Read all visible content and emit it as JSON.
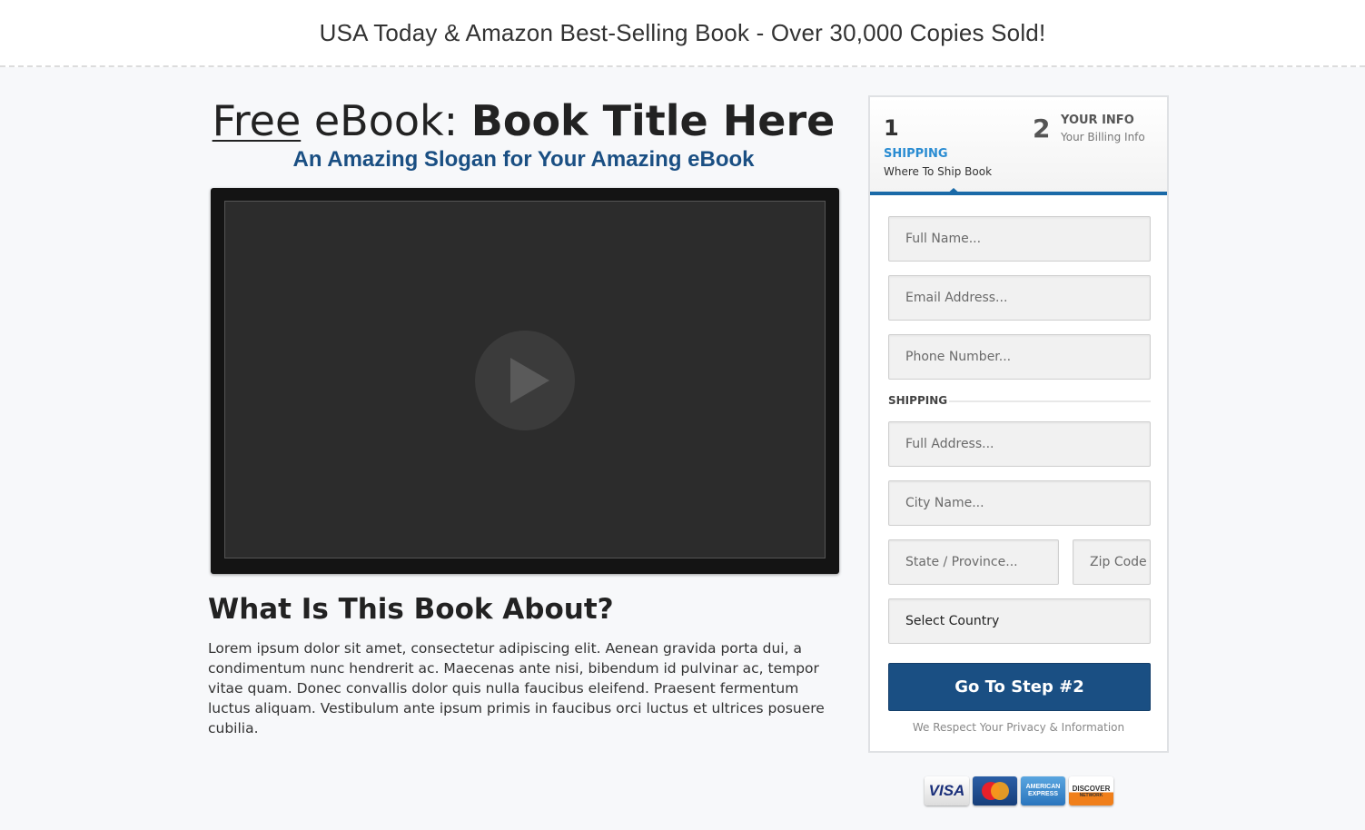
{
  "banner": {
    "text": "USA Today & Amazon Best-Selling Book - Over 30,000 Copies Sold!"
  },
  "hero": {
    "title_free": "Free",
    "title_ebook": " eBook: ",
    "title_book": "Book Title Here",
    "slogan": "An Amazing Slogan for Your Amazing eBook"
  },
  "about": {
    "heading": "What Is This Book About?",
    "body": "Lorem ipsum dolor sit amet, consectetur adipiscing elit. Aenean gravida porta dui, a condimentum nunc hendrerit ac. Maecenas ante nisi, bibendum id pulvinar ac, tempor vitae quam. Donec convallis dolor quis nulla faucibus eleifend. Praesent fermentum luctus aliquam. Vestibulum ante ipsum primis in faucibus orci luctus et ultrices posuere cubilia."
  },
  "steps": {
    "step1": {
      "num": "1",
      "title": "SHIPPING",
      "sub": "Where To Ship Book"
    },
    "step2": {
      "num": "2",
      "title": "YOUR INFO",
      "sub": "Your Billing Info"
    }
  },
  "form": {
    "full_name_ph": "Full Name...",
    "email_ph": "Email Address...",
    "phone_ph": "Phone Number...",
    "shipping_label": "SHIPPING",
    "address_ph": "Full Address...",
    "city_ph": "City Name...",
    "state_ph": "State / Province...",
    "zip_ph": "Zip Code",
    "country_selected": "Select Country",
    "submit_label": "Go To Step #2",
    "privacy": "We Respect Your Privacy & Information"
  },
  "payment_cards": {
    "visa": "VISA",
    "amex": "AMERICAN EXPRESS",
    "discover": "DISCOVER",
    "discover_sub": "NETWORK"
  },
  "colors": {
    "accent": "#1a4f83",
    "step_active": "#2a8cd2",
    "step_bar": "#1a6aa8"
  }
}
